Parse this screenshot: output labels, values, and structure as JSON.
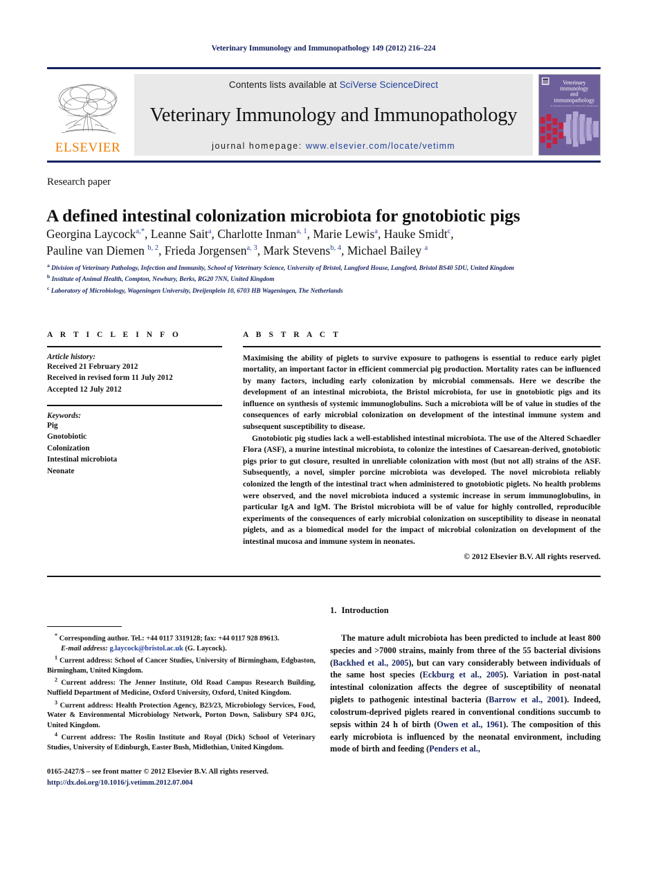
{
  "running_head": "Veterinary Immunology and Immunopathology 149 (2012) 216–224",
  "colors": {
    "rule_navy": "#14225e",
    "link_blue": "#1f3d99",
    "citation_navy": "#14225e",
    "elsevier_orange": "#f07d00",
    "band_gray": "#e9e9e9",
    "cover_purple": "#6e5f9b",
    "cover_red": "#c8203c"
  },
  "masthead": {
    "publisher_logo_label": "ELSEVIER",
    "contents_prefix": "Contents lists available at ",
    "contents_link": "SciVerse ScienceDirect",
    "journal_name": "Veterinary Immunology and Immunopathology",
    "homepage_prefix": "journal homepage: ",
    "homepage_url": "www.elsevier.com/locate/vetimm",
    "cover": {
      "line1": "Veterinary",
      "line2": "immunology",
      "line3": "and",
      "line4": "immunopathology",
      "line5": "an international journal of comparative immunology"
    }
  },
  "article": {
    "type": "Research paper",
    "title": "A defined intestinal colonization microbiota for gnotobiotic pigs",
    "authors_line1_html": "Georgina Laycock<sup>a,*</sup>, Leanne Sait<sup>a</sup>, Charlotte Inman<sup>a, 1</sup>, Marie Lewis<sup>a</sup>, Hauke Smidt<sup>c</sup>,",
    "authors_line2_html": "Pauline van Diemen <sup>b, 2</sup>, Frieda Jorgensen<sup>a, 3</sup>, Mark Stevens<sup>b, 4</sup>, Michael Bailey <sup>a</sup>",
    "affiliations": [
      {
        "marker": "a",
        "text": "Division of Veterinary Pathology, Infection and Immunity, School of Veterinary Science, University of Bristol, Langford House, Langford, Bristol BS40 5DU, United Kingdom"
      },
      {
        "marker": "b",
        "text": "Institute of Animal Health, Compton, Newbury, Berks, RG20 7NN, United Kingdom"
      },
      {
        "marker": "c",
        "text": "Laboratory of Microbiology, Wageningen University, Dreijenplein 10, 6703 HB Wageningen, The Netherlands"
      }
    ]
  },
  "article_info": {
    "heading": "A R T I C L E   I N F O",
    "history_label": "Article history:",
    "history": [
      "Received 21 February 2012",
      "Received in revised form 11 July 2012",
      "Accepted 12 July 2012"
    ],
    "keywords_label": "Keywords:",
    "keywords": [
      "Pig",
      "Gnotobiotic",
      "Colonization",
      "Intestinal microbiota",
      "Neonate"
    ]
  },
  "abstract": {
    "heading": "A B S T R A C T",
    "paragraphs": [
      "Maximising the ability of piglets to survive exposure to pathogens is essential to reduce early piglet mortality, an important factor in efficient commercial pig production. Mortality rates can be influenced by many factors, including early colonization by microbial commensals. Here we describe the development of an intestinal microbiota, the Bristol microbiota, for use in gnotobiotic pigs and its influence on synthesis of systemic immunoglobulins. Such a microbiota will be of value in studies of the consequences of early microbial colonization on development of the intestinal immune system and subsequent susceptibility to disease.",
      "Gnotobiotic pig studies lack a well-established intestinal microbiota. The use of the Altered Schaedler Flora (ASF), a murine intestinal microbiota, to colonize the intestines of Caesarean-derived, gnotobiotic pigs prior to gut closure, resulted in unreliable colonization with most (but not all) strains of the ASF. Subsequently, a novel, simpler porcine microbiota was developed. The novel microbiota reliably colonized the length of the intestinal tract when administered to gnotobiotic piglets. No health problems were observed, and the novel microbiota induced a systemic increase in serum immunoglobulins, in particular IgA and IgM. The Bristol microbiota will be of value for highly controlled, reproducible experiments of the consequences of early microbial colonization on susceptibility to disease in neonatal piglets, and as a biomedical model for the impact of microbial colonization on development of the intestinal mucosa and immune system in neonates."
    ],
    "copyright": "© 2012 Elsevier B.V. All rights reserved."
  },
  "footnotes": {
    "corresponding_marker": "*",
    "corresponding_text": "Corresponding author. Tel.: +44 0117 3319128; fax: +44 0117 928 89613.",
    "email_label": "E-mail address:",
    "email_value": "g.laycock@bristol.ac.uk",
    "email_suffix": " (G. Laycock).",
    "items": [
      {
        "marker": "1",
        "text": "Current address: School of Cancer Studies, University of Birmingham, Edgbaston, Birmingham, United Kingdom."
      },
      {
        "marker": "2",
        "text": "Current address: The Jenner Institute, Old Road Campus Research Building, Nuffield Department of Medicine, Oxford University, Oxford, United Kingdom."
      },
      {
        "marker": "3",
        "text": "Current address: Health Protection Agency, B23/23, Microbiology Services, Food, Water & Environmental Microbiology Network, Porton Down, Salisbury SP4 0JG, United Kingdom."
      },
      {
        "marker": "4",
        "text": "Current address: The Roslin Institute and Royal (Dick) School of Veterinary Studies, University of Edinburgh, Easter Bush, Midlothian, United Kingdom."
      }
    ]
  },
  "front_matter": {
    "line": "0165-2427/$ – see front matter © 2012 Elsevier B.V. All rights reserved.",
    "doi": "http://dx.doi.org/10.1016/j.vetimm.2012.07.004"
  },
  "introduction": {
    "number": "1.",
    "heading": "Introduction",
    "paragraph_segments": [
      {
        "t": "The mature adult microbiota has been predicted to include at least 800 species and >7000 strains, mainly from three of the 55 bacterial divisions (",
        "cite": false
      },
      {
        "t": "Backhed et al., 2005",
        "cite": true
      },
      {
        "t": "), but can vary considerably between individuals of the same host species (",
        "cite": false
      },
      {
        "t": "Eckburg et al., 2005",
        "cite": true
      },
      {
        "t": "). Variation in post-natal intestinal colonization affects the degree of susceptibility of neonatal piglets to pathogenic intestinal bacteria (",
        "cite": false
      },
      {
        "t": "Barrow et al., 2001",
        "cite": true
      },
      {
        "t": "). Indeed, colostrum-deprived piglets reared in conventional conditions succumb to sepsis within 24 h of birth (",
        "cite": false
      },
      {
        "t": "Owen et al., 1961",
        "cite": true
      },
      {
        "t": "). The composition of this early microbiota is influenced by the neonatal environment, including mode of birth and feeding (",
        "cite": false
      },
      {
        "t": "Penders et al.,",
        "cite": true
      }
    ]
  }
}
